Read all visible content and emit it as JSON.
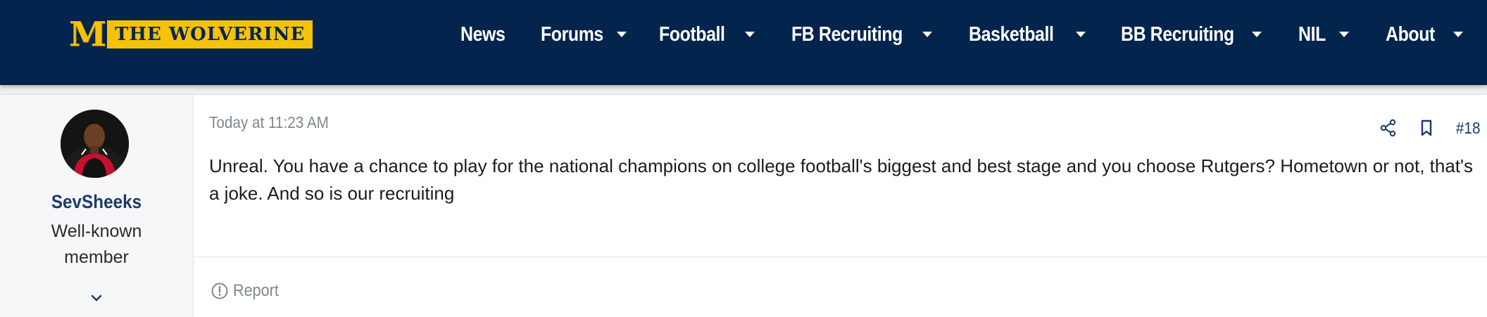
{
  "site": {
    "logo_mark": "M",
    "logo_text": "THE WOLVERINE",
    "colors": {
      "header_bg": "#03244d",
      "logo_gold": "#f5c20a",
      "link_blue": "#1d3b6a"
    }
  },
  "nav": {
    "items": [
      {
        "label": "News",
        "has_dropdown": false
      },
      {
        "label": "Forums",
        "has_dropdown": true
      },
      {
        "label": "Football",
        "has_dropdown": true
      },
      {
        "label": "FB Recruiting",
        "has_dropdown": true
      },
      {
        "label": "Basketball",
        "has_dropdown": true
      },
      {
        "label": "BB Recruiting",
        "has_dropdown": true
      },
      {
        "label": "NIL",
        "has_dropdown": true
      },
      {
        "label": "About",
        "has_dropdown": true
      }
    ]
  },
  "post": {
    "user": {
      "name": "SevSheeks",
      "title_line1": "Well-known",
      "title_line2": "member",
      "avatar_icon": "avatar-basketball-player"
    },
    "timestamp": "Today at 11:23 AM",
    "number": "#18",
    "message": "Unreal. You have a chance to play for the national champions on college football's biggest and best stage and you choose Rutgers? Hometown or not, that's a joke. And so is our recruiting",
    "actions": {
      "share_icon": "share-icon",
      "bookmark_icon": "bookmark-icon"
    },
    "report_label": "Report"
  }
}
